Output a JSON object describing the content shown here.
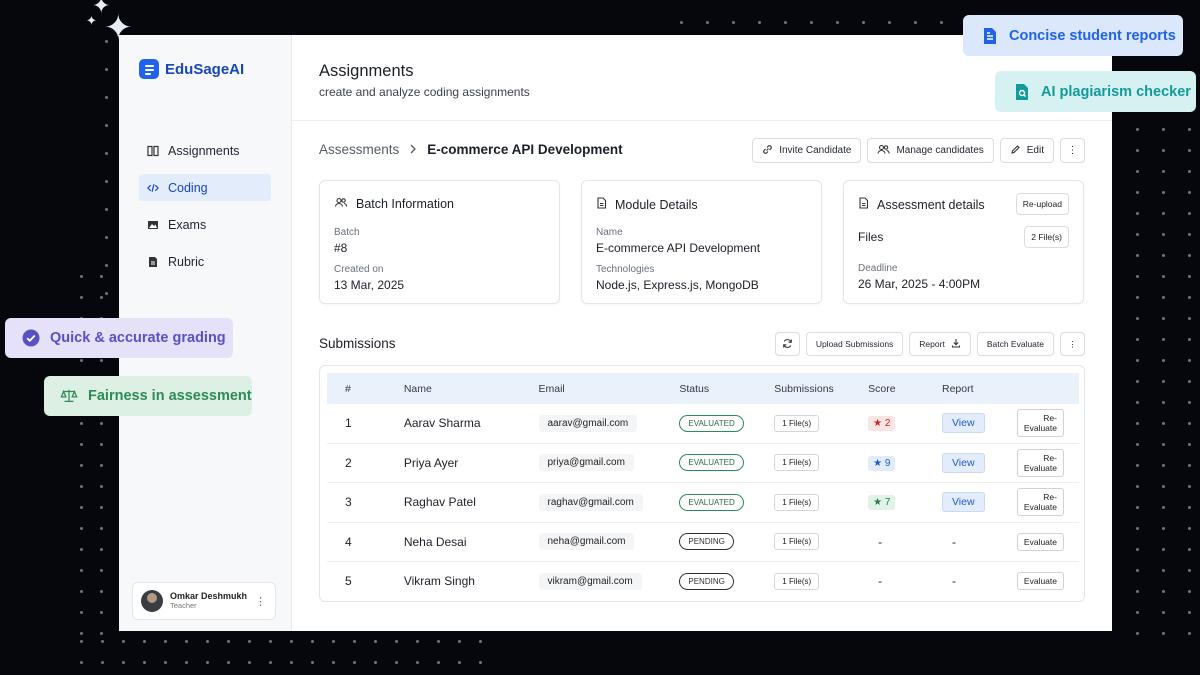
{
  "brand": {
    "name": "EduSageAI",
    "color": "#1e63e9"
  },
  "sidebar": {
    "items": [
      {
        "label": "Assignments",
        "icon": "book-icon",
        "active": false
      },
      {
        "label": "Coding",
        "icon": "code-icon",
        "active": true
      },
      {
        "label": "Exams",
        "icon": "image-icon",
        "active": false
      },
      {
        "label": "Rubric",
        "icon": "document-icon",
        "active": false
      }
    ],
    "user": {
      "name": "Omkar Deshmukh",
      "role": "Teacher"
    }
  },
  "header": {
    "title": "Assignments",
    "subtitle": "create and analyze coding assignments"
  },
  "breadcrumb": {
    "root": "Assessments",
    "current": "E-commerce API Development"
  },
  "actions": {
    "invite": "Invite Candidate",
    "manage": "Manage candidates",
    "edit": "Edit"
  },
  "cards": {
    "batch": {
      "title": "Batch Information",
      "batch_label": "Batch",
      "batch_value": "#8",
      "created_label": "Created on",
      "created_value": "13 Mar, 2025"
    },
    "module": {
      "title": "Module Details",
      "name_label": "Name",
      "name_value": "E-commerce API Development",
      "tech_label": "Technologies",
      "tech_value": "Node.js, Express.js, MongoDB"
    },
    "assessment": {
      "title": "Assessment details",
      "reupload": "Re-upload",
      "files_label": "Files",
      "files_count": "2 File(s)",
      "deadline_label": "Deadline",
      "deadline_value": "26 Mar, 2025 - 4:00PM"
    }
  },
  "submissions": {
    "title": "Submissions",
    "upload": "Upload Submissions",
    "report": "Report",
    "batch_evaluate": "Batch Evaluate",
    "columns": [
      "#",
      "Name",
      "Email",
      "Status",
      "Submissions",
      "Score",
      "Report"
    ],
    "rows": [
      {
        "num": "1",
        "name": "Aarav Sharma",
        "email": "aarav@gmail.com",
        "status": "EVALUATED",
        "files": "1 File(s)",
        "score": "2",
        "score_color": "#c62828",
        "score_bg": "#fbe4e4",
        "report": "View",
        "action": "Re-Evaluate"
      },
      {
        "num": "2",
        "name": "Priya Ayer",
        "email": "priya@gmail.com",
        "status": "EVALUATED",
        "files": "1 File(s)",
        "score": "9",
        "score_color": "#1e5bd0",
        "score_bg": "#e2ecfa",
        "report": "View",
        "action": "Re-Evaluate"
      },
      {
        "num": "3",
        "name": "Raghav Patel",
        "email": "raghav@gmail.com",
        "status": "EVALUATED",
        "files": "1 File(s)",
        "score": "7",
        "score_color": "#2d7a4a",
        "score_bg": "#e1f3e7",
        "report": "View",
        "action": "Re-Evaluate"
      },
      {
        "num": "4",
        "name": "Neha Desai",
        "email": "neha@gmail.com",
        "status": "PENDING",
        "files": "1 File(s)",
        "score": "-",
        "report": "-",
        "action": "Evaluate"
      },
      {
        "num": "5",
        "name": "Vikram Singh",
        "email": "vikram@gmail.com",
        "status": "PENDING",
        "files": "1 File(s)",
        "score": "-",
        "report": "-",
        "action": "Evaluate"
      }
    ]
  },
  "features": {
    "reports": {
      "label": "Concise student reports",
      "color": "#1e63e9",
      "bg": "#dbe7fb",
      "icon": "document-icon"
    },
    "plagiarism": {
      "label": "AI plagiarism checker",
      "color": "#139a9a",
      "bg": "#d6f1f1",
      "icon": "file-search-icon"
    },
    "grading": {
      "label": "Quick & accurate grading",
      "color": "#5b4fc4",
      "bg": "#e4e1f8",
      "icon": "check-circle-icon"
    },
    "fairness": {
      "label": "Fairness in assessment",
      "color": "#2f8a55",
      "bg": "#dcf1e4",
      "icon": "scale-icon"
    }
  }
}
